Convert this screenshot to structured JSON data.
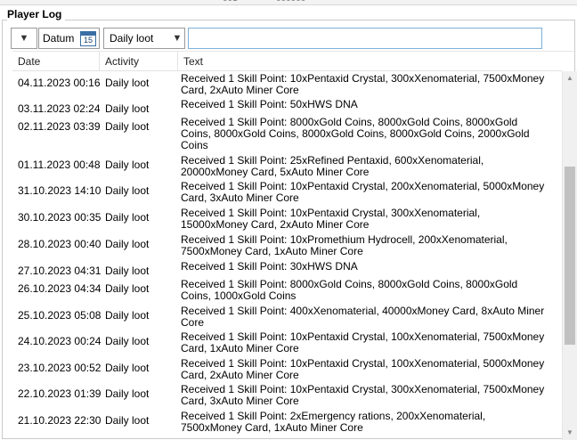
{
  "top_strip": [
    "001",
    "000000"
  ],
  "panel": {
    "title": "Player Log"
  },
  "toolbar": {
    "date_label": "Datum",
    "calendar_day": "15",
    "activity_value": "Daily loot",
    "text_filter_value": ""
  },
  "icons": {
    "dropdown": "chevron-down-icon",
    "calendar": "calendar-icon",
    "scroll_up": "scroll-up-arrow-icon",
    "scroll_down": "scroll-down-arrow-icon"
  },
  "columns": {
    "date": "Date",
    "activity": "Activity",
    "text": "Text"
  },
  "scroll": {
    "thumb_position": 0.5
  },
  "rows": [
    {
      "date": "04.11.2023 00:16",
      "activity": "Daily loot",
      "text": "Received 1 Skill Point: 10xPentaxid Crystal, 300xXenomaterial, 7500xMoney Card, 2xAuto Miner Core"
    },
    {
      "date": "03.11.2023 02:24",
      "activity": "Daily loot",
      "text": "Received 1 Skill Point: 50xHWS DNA"
    },
    {
      "date": "02.11.2023 03:39",
      "activity": "Daily loot",
      "text": "Received 1 Skill Point: 8000xGold Coins, 8000xGold Coins, 8000xGold Coins, 8000xGold Coins, 8000xGold Coins, 8000xGold Coins, 2000xGold Coins"
    },
    {
      "date": "01.11.2023 00:48",
      "activity": "Daily loot",
      "text": "Received 1 Skill Point: 25xRefined Pentaxid, 600xXenomaterial, 20000xMoney Card, 5xAuto Miner Core"
    },
    {
      "date": "31.10.2023 14:10",
      "activity": "Daily loot",
      "text": "Received 1 Skill Point: 10xPentaxid Crystal, 200xXenomaterial, 5000xMoney Card, 3xAuto Miner Core"
    },
    {
      "date": "30.10.2023 00:35",
      "activity": "Daily loot",
      "text": "Received 1 Skill Point: 10xPentaxid Crystal, 300xXenomaterial, 15000xMoney Card, 2xAuto Miner Core"
    },
    {
      "date": "28.10.2023 00:40",
      "activity": "Daily loot",
      "text": "Received 1 Skill Point: 10xPromethium Hydrocell, 200xXenomaterial, 7500xMoney Card, 1xAuto Miner Core"
    },
    {
      "date": "27.10.2023 04:31",
      "activity": "Daily loot",
      "text": "Received 1 Skill Point: 30xHWS DNA"
    },
    {
      "date": "26.10.2023 04:34",
      "activity": "Daily loot",
      "text": "Received 1 Skill Point: 8000xGold Coins, 8000xGold Coins, 8000xGold Coins, 1000xGold Coins"
    },
    {
      "date": "25.10.2023 05:08",
      "activity": "Daily loot",
      "text": "Received 1 Skill Point: 400xXenomaterial, 40000xMoney Card, 8xAuto Miner Core"
    },
    {
      "date": "24.10.2023 00:24",
      "activity": "Daily loot",
      "text": "Received 1 Skill Point: 10xPentaxid Crystal, 100xXenomaterial, 7500xMoney Card, 1xAuto Miner Core"
    },
    {
      "date": "23.10.2023 00:52",
      "activity": "Daily loot",
      "text": "Received 1 Skill Point: 10xPentaxid Crystal, 100xXenomaterial, 5000xMoney Card, 2xAuto Miner Core"
    },
    {
      "date": "22.10.2023 01:39",
      "activity": "Daily loot",
      "text": "Received 1 Skill Point: 10xPentaxid Crystal, 300xXenomaterial, 7500xMoney Card, 3xAuto Miner Core"
    },
    {
      "date": "21.10.2023 22:30",
      "activity": "Daily loot",
      "text": "Received 1 Skill Point: 2xEmergency rations, 200xXenomaterial, 7500xMoney Card, 1xAuto Miner Core"
    }
  ]
}
